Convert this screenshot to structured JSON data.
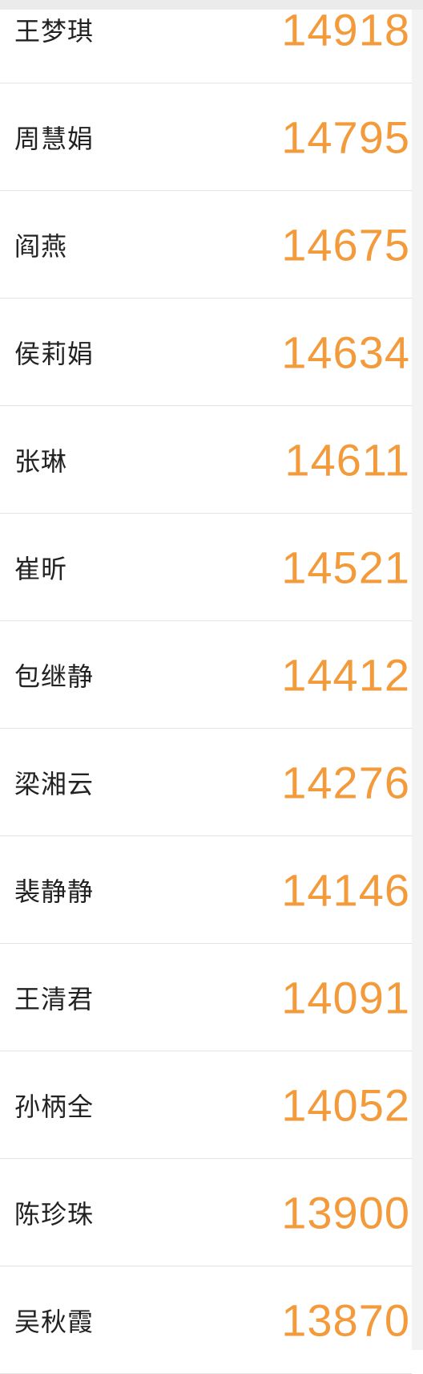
{
  "colors": {
    "score": "#f39a3b",
    "name": "#222222",
    "divider": "#e3e3e3",
    "topbar": "#ebebeb"
  },
  "rows": [
    {
      "name": "王梦琪",
      "score": "14918"
    },
    {
      "name": "周慧娟",
      "score": "14795"
    },
    {
      "name": "阎燕",
      "score": "14675"
    },
    {
      "name": "侯莉娟",
      "score": "14634"
    },
    {
      "name": "张琳",
      "score": "14611"
    },
    {
      "name": "崔昕",
      "score": "14521"
    },
    {
      "name": "包继静",
      "score": "14412"
    },
    {
      "name": "梁湘云",
      "score": "14276"
    },
    {
      "name": "裴静静",
      "score": "14146"
    },
    {
      "name": "王清君",
      "score": "14091"
    },
    {
      "name": "孙柄全",
      "score": "14052"
    },
    {
      "name": "陈珍珠",
      "score": "13900"
    },
    {
      "name": "吴秋霞",
      "score": "13870"
    }
  ]
}
